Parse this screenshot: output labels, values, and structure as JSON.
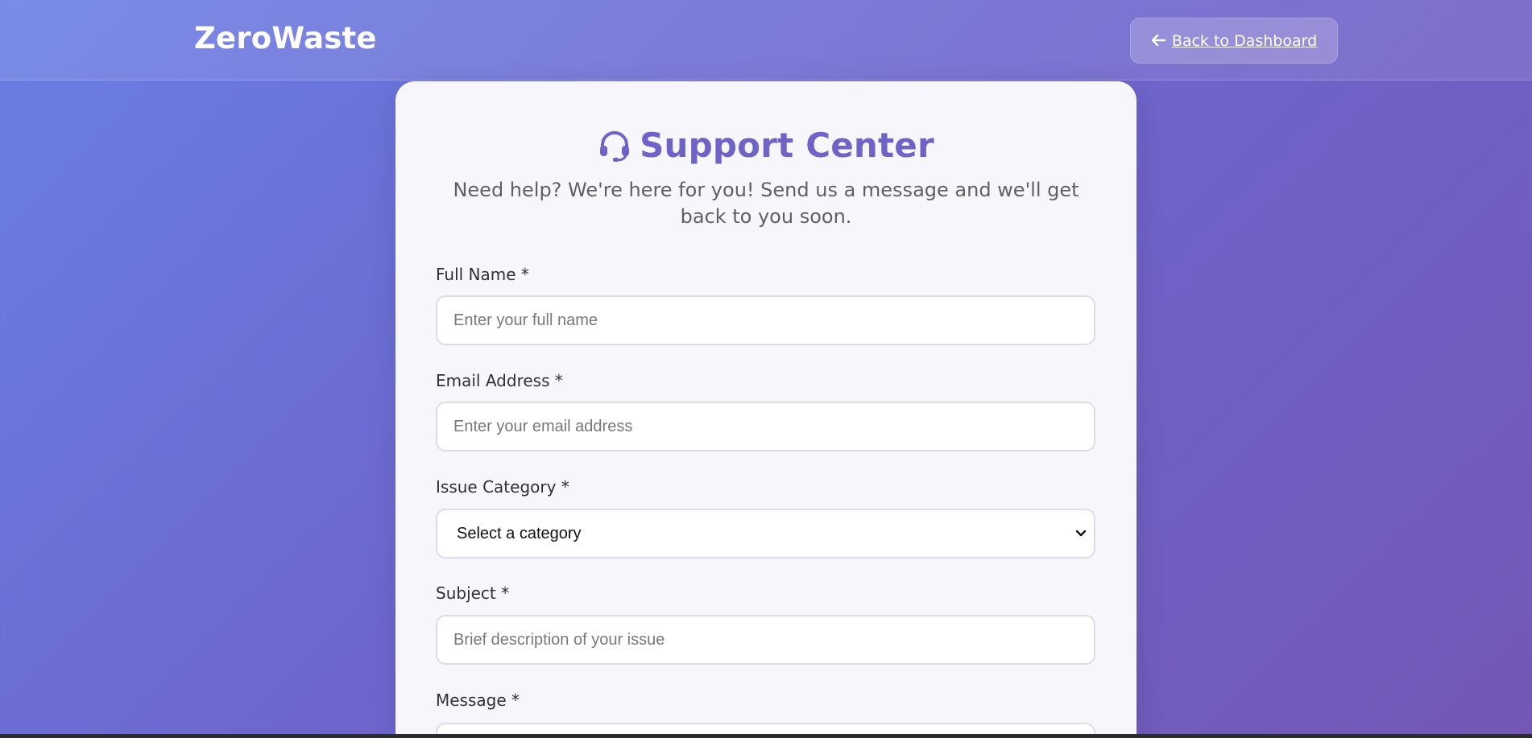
{
  "header": {
    "brand": "ZeroWaste",
    "back_button": {
      "label": "Back to Dashboard",
      "icon": "arrow-left-icon"
    }
  },
  "support": {
    "icon": "headset-icon",
    "title": "Support Center",
    "subtitle": "Need help? We're here for you! Send us a message and we'll get back to you soon."
  },
  "form": {
    "full_name": {
      "label": "Full Name *",
      "placeholder": "Enter your full name",
      "value": ""
    },
    "email": {
      "label": "Email Address *",
      "placeholder": "Enter your email address",
      "value": ""
    },
    "category": {
      "label": "Issue Category *",
      "selected": "Select a category"
    },
    "subject": {
      "label": "Subject *",
      "placeholder": "Brief description of your issue",
      "value": ""
    },
    "message": {
      "label": "Message *"
    }
  },
  "colors": {
    "accent": "#6f63c8",
    "brand_text": "#ffffff",
    "background_start": "#6a7fe4",
    "background_end": "#7457b5"
  }
}
